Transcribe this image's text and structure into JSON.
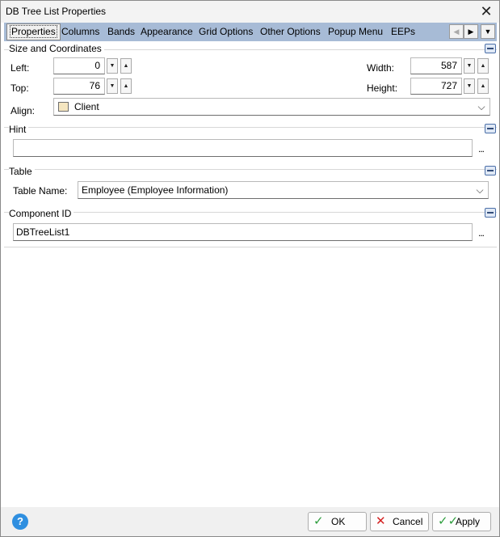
{
  "window": {
    "title": "DB Tree List Properties",
    "close_glyph": "✕"
  },
  "tabs": [
    "Properties",
    "Columns",
    "Bands",
    "Appearance",
    "Grid Options",
    "Other Options",
    "Popup Menu",
    "EEPs"
  ],
  "tab_controls": {
    "left": "◀",
    "right": "▶",
    "menu": "▼"
  },
  "sections": {
    "size": {
      "title": "Size and Coordinates",
      "left_label": "Left:",
      "left_value": "0",
      "top_label": "Top:",
      "top_value": "76",
      "width_label": "Width:",
      "width_value": "587",
      "height_label": "Height:",
      "height_value": "727",
      "align_label": "Align:",
      "align_value": "Client"
    },
    "hint": {
      "title": "Hint",
      "value": "",
      "ellipsis": "..."
    },
    "table": {
      "title": "Table",
      "label": "Table Name:",
      "value": "Employee  (Employee Information)"
    },
    "component": {
      "title": "Component ID",
      "value": "DBTreeList1",
      "ellipsis": "..."
    }
  },
  "spin": {
    "down": "▼",
    "up": "▲"
  },
  "combo_arrow": "⌵",
  "buttons": {
    "ok": "OK",
    "cancel": "Cancel",
    "apply": "Apply",
    "help": "?"
  },
  "colors": {
    "tab_strip": "#a7bbd6",
    "help": "#2f8fe0",
    "ok_check": "#2e9e3e",
    "cancel_x": "#d42020"
  }
}
